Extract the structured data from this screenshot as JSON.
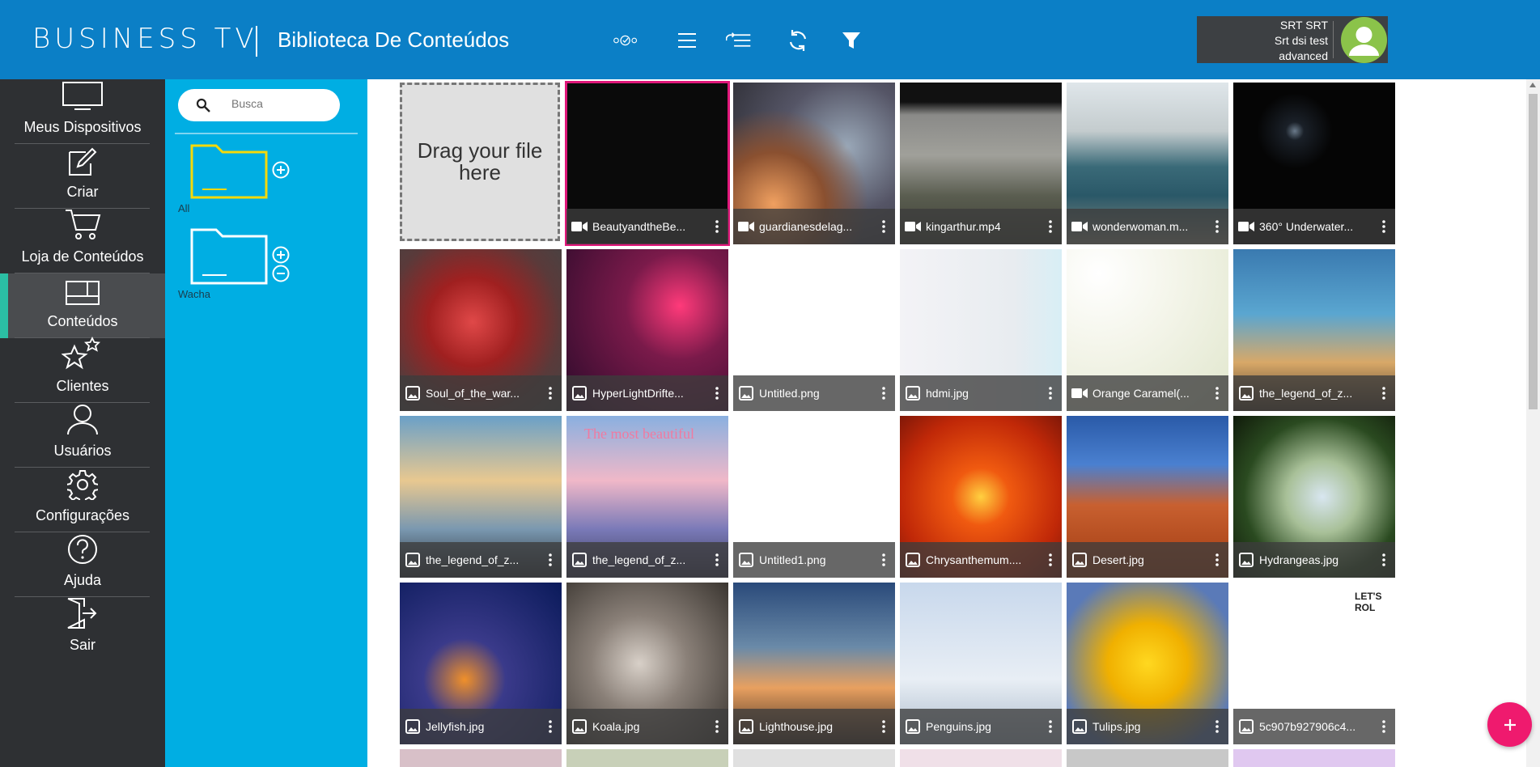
{
  "header": {
    "brand": "BUSINESS TV",
    "title": "Biblioteca De Conteúdos",
    "toolbar_icons": [
      "status-icon",
      "list-icon",
      "sort-list-icon",
      "refresh-icon",
      "filter-icon"
    ],
    "user": {
      "line1": "SRT SRT",
      "line2": "Srt dsi test",
      "line3": "advanced"
    }
  },
  "sidebar": {
    "items": [
      {
        "label": "Meus Dispositivos",
        "icon": "monitor-icon"
      },
      {
        "label": "Criar",
        "icon": "edit-icon"
      },
      {
        "label": "Loja de Conteúdos",
        "icon": "cart-icon"
      },
      {
        "label": "Conteúdos",
        "icon": "layout-icon",
        "active": true
      },
      {
        "label": "Clientes",
        "icon": "stars-icon"
      },
      {
        "label": "Usuários",
        "icon": "user-icon"
      },
      {
        "label": "Configurações",
        "icon": "gear-icon"
      },
      {
        "label": "Ajuda",
        "icon": "help-icon"
      },
      {
        "label": "Sair",
        "icon": "logout-icon"
      }
    ]
  },
  "folders": {
    "search_placeholder": "Busca",
    "items": [
      {
        "label": "All",
        "color": "#f5d90a"
      },
      {
        "label": "Wacha",
        "color": "#ffffff"
      }
    ]
  },
  "grid": {
    "drop_zone": "Drag your file here",
    "tiles": [
      {
        "name": "BeautyandtheBe...",
        "type": "video",
        "selected": true
      },
      {
        "name": "guardianesdelag...",
        "type": "video"
      },
      {
        "name": "kingarthur.mp4",
        "type": "video"
      },
      {
        "name": "wonderwoman.m...",
        "type": "video"
      },
      {
        "name": "360° Underwater...",
        "type": "video"
      },
      {
        "name": "Soul_of_the_war...",
        "type": "image"
      },
      {
        "name": "HyperLightDrifte...",
        "type": "image"
      },
      {
        "name": "Untitled.png",
        "type": "image"
      },
      {
        "name": "hdmi.jpg",
        "type": "image"
      },
      {
        "name": "Orange Caramel(...",
        "type": "video"
      },
      {
        "name": "the_legend_of_z...",
        "type": "image"
      },
      {
        "name": "the_legend_of_z...",
        "type": "image"
      },
      {
        "name": "the_legend_of_z...",
        "type": "image"
      },
      {
        "name": "Untitled1.png",
        "type": "image"
      },
      {
        "name": "Chrysanthemum....",
        "type": "image"
      },
      {
        "name": "Desert.jpg",
        "type": "image"
      },
      {
        "name": "Hydrangeas.jpg",
        "type": "image"
      },
      {
        "name": "Jellyfish.jpg",
        "type": "image"
      },
      {
        "name": "Koala.jpg",
        "type": "image"
      },
      {
        "name": "Lighthouse.jpg",
        "type": "image"
      },
      {
        "name": "Penguins.jpg",
        "type": "image"
      },
      {
        "name": "Tulips.jpg",
        "type": "image"
      },
      {
        "name": "5c907b927906c4...",
        "type": "image"
      }
    ],
    "thumb_texts": {
      "untitled1": "The most beautiful",
      "sticker": "LET'S ROL"
    }
  },
  "colors": {
    "header": "#0b7fc6",
    "sidebar": "#2e3033",
    "folder_panel": "#00aee3",
    "accent": "#2bbfa4",
    "fab": "#ef1a6e",
    "selection": "#e0177a"
  }
}
